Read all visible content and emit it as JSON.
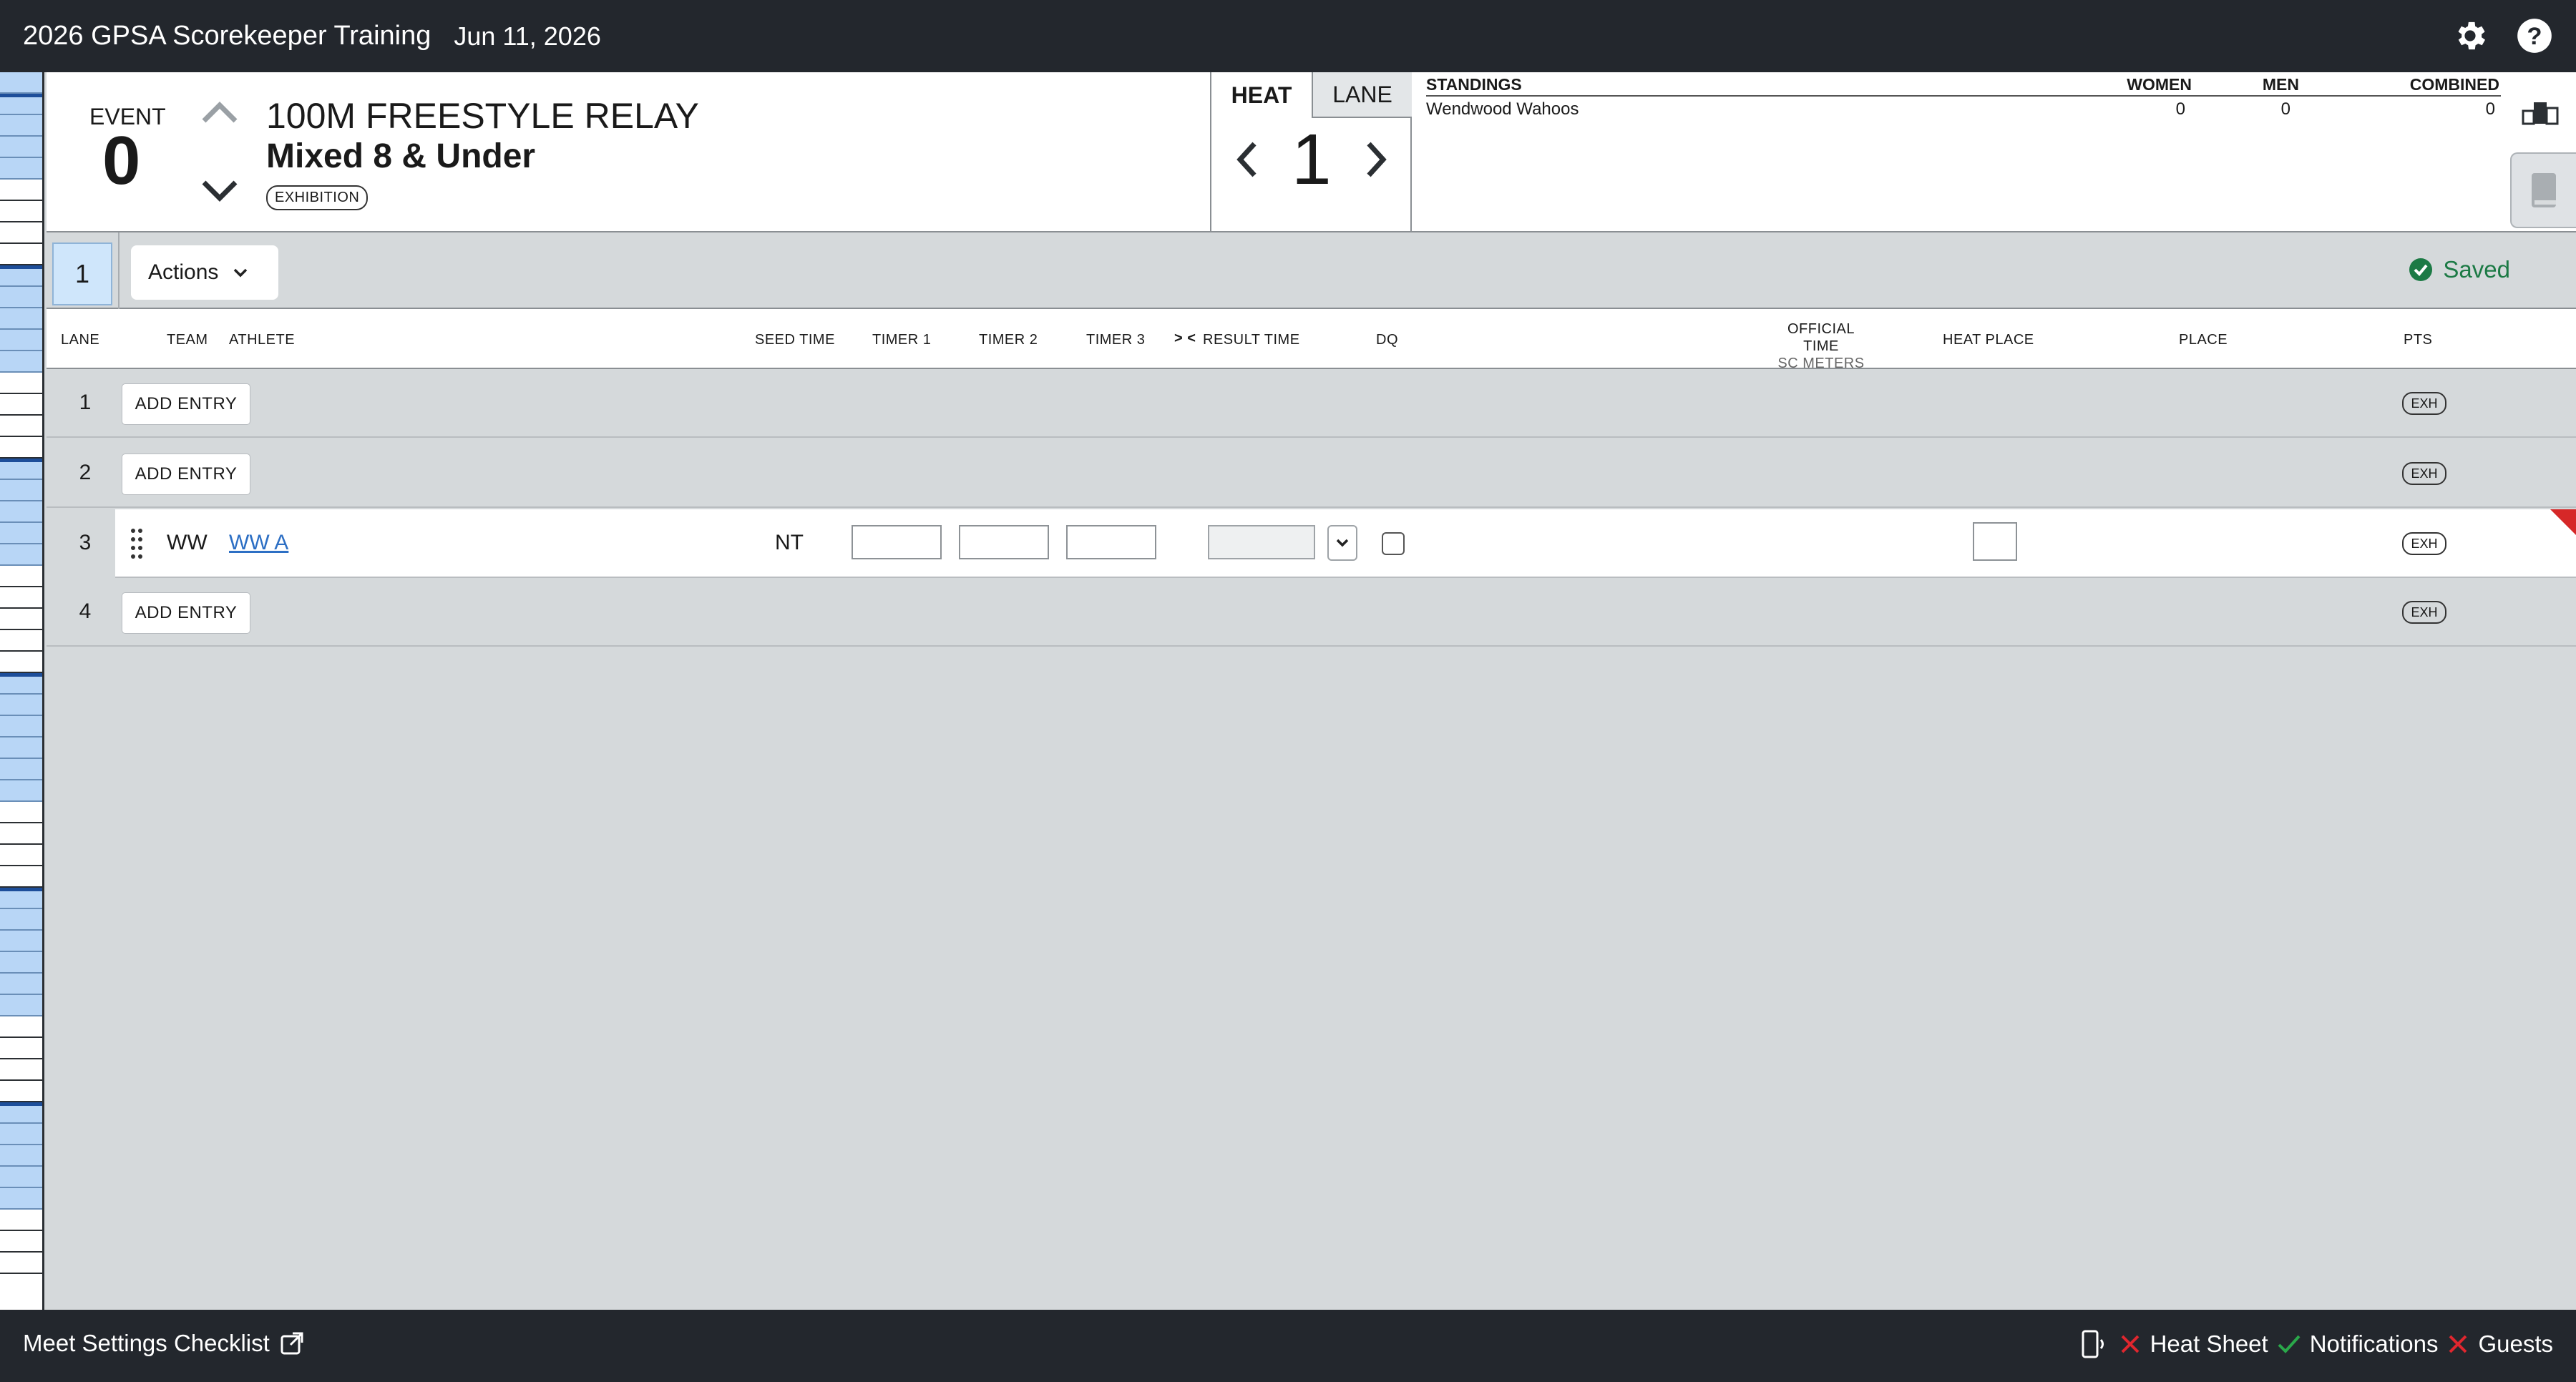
{
  "app": {
    "title": "2026 GPSA Scorekeeper Training",
    "date": "Jun 11, 2026"
  },
  "header": {
    "event_label": "EVENT",
    "event_number": "0",
    "event_name": "100M FREESTYLE RELAY",
    "event_subtitle": "Mixed 8 & Under",
    "event_badge": "EXHIBITION",
    "heat_tab": "HEAT",
    "lane_tab": "LANE",
    "heat_number": "1"
  },
  "standings": {
    "title": "STANDINGS",
    "columns": [
      "WOMEN",
      "MEN",
      "COMBINED"
    ],
    "rows": [
      {
        "team": "Wendwood Wahoos",
        "women": "0",
        "men": "0",
        "combined": "0"
      }
    ]
  },
  "toolbar": {
    "heat_chip": "1",
    "actions_label": "Actions",
    "saved_label": "Saved"
  },
  "table": {
    "headers": {
      "lane": "LANE",
      "team": "TEAM",
      "athlete": "ATHLETE",
      "seed": "SEED TIME",
      "timer1": "TIMER 1",
      "timer2": "TIMER 2",
      "timer3": "TIMER 3",
      "swap": "> <",
      "result": "RESULT TIME",
      "dq": "DQ",
      "official": "OFFICIAL TIME",
      "official_sub": "SC METERS",
      "heat_place": "HEAT PLACE",
      "place": "PLACE",
      "pts": "PTS"
    },
    "add_entry_label": "ADD ENTRY",
    "exh_label": "EXH",
    "rows": [
      {
        "lane": "1"
      },
      {
        "lane": "2"
      },
      {
        "lane": "3",
        "team": "WW",
        "athlete": "WW A",
        "seed": "NT"
      },
      {
        "lane": "4"
      }
    ]
  },
  "footer": {
    "checklist_label": "Meet Settings Checklist",
    "heat_sheet": "Heat Sheet",
    "notifications": "Notifications",
    "guests": "Guests"
  },
  "colors": {
    "topbar": "#23272d",
    "accent_blue": "#2d6fc4",
    "saved_green": "#1c7a45",
    "error_red": "#e0262e",
    "ok_green": "#2aa84a"
  }
}
